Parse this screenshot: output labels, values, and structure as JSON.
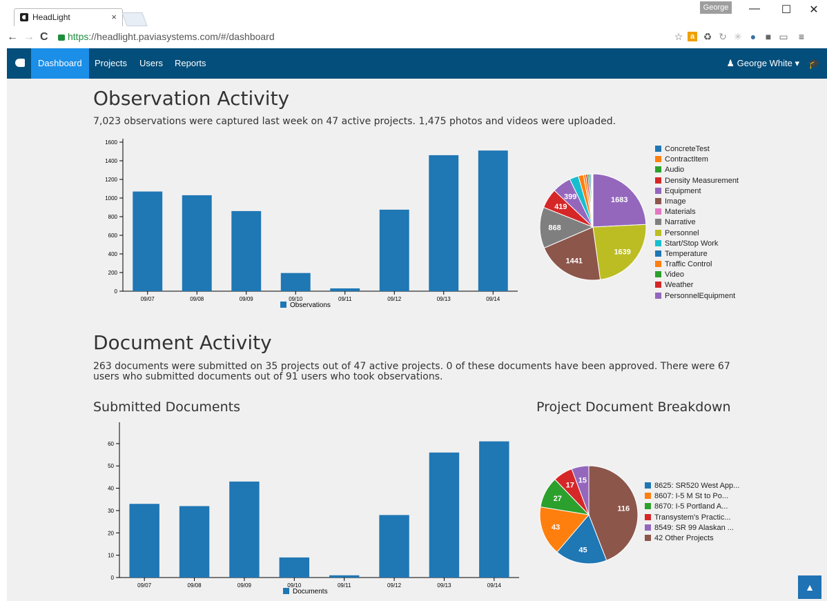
{
  "browser": {
    "tab_title": "HeadLight",
    "tab_close": "×",
    "profile_name": "George",
    "url_scheme": "https",
    "url_rest": "://headlight.paviasystems.com/#/dashboard",
    "win_min": "—",
    "win_max": "☐",
    "win_close": "✕"
  },
  "nav": {
    "items": [
      {
        "label": "Dashboard",
        "active": true
      },
      {
        "label": "Projects"
      },
      {
        "label": "Users"
      },
      {
        "label": "Reports"
      }
    ],
    "user": "George White",
    "user_caret": "▾"
  },
  "observation": {
    "title": "Observation Activity",
    "summary": "7,023 observations were captured last week on 47 active projects. 1,475 photos and videos were uploaded."
  },
  "documents": {
    "title": "Document Activity",
    "summary_line1": "263 documents were submitted on 35 projects out of 47 active projects. 0 of these documents have been approved. There were 67",
    "summary_line2": "users who submitted documents out of 91 users who took observations.",
    "submitted_title": "Submitted Documents",
    "breakdown_title": "Project Document Breakdown"
  },
  "colors": {
    "accent": "#1f77b4",
    "navbar": "#034e7b",
    "nav_active": "#1b8ee8"
  },
  "chart_data": [
    {
      "type": "bar",
      "categories": [
        "09/07",
        "09/08",
        "09/09",
        "09/10",
        "09/11",
        "09/12",
        "09/13",
        "09/14"
      ],
      "values": [
        1070,
        1030,
        860,
        195,
        30,
        875,
        1460,
        1510
      ],
      "ylim": [
        0,
        1600
      ],
      "yticks": [
        0,
        200,
        400,
        600,
        800,
        1000,
        1200,
        1400,
        1600
      ],
      "legend": [
        "Observations"
      ],
      "color": "#1f77b4"
    },
    {
      "type": "pie",
      "labels": [
        "ConcreteTest",
        "ContractItem",
        "Audio",
        "Density Measurement",
        "Equipment",
        "Image",
        "Materials",
        "Narrative",
        "Personnel",
        "Start/Stop Work",
        "Temperature",
        "Traffic Control",
        "Video",
        "Weather",
        "PersonnelEquipment"
      ],
      "colors": [
        "#1f77b4",
        "#ff7f0e",
        "#2ca02c",
        "#d62728",
        "#9467bd",
        "#8c564b",
        "#e377c2",
        "#7f7f7f",
        "#bcbd22",
        "#17becf",
        "#1f77b4",
        "#ff7f0e",
        "#2ca02c",
        "#d62728",
        "#9467bd"
      ],
      "slices": [
        {
          "label": "PersonnelEquipment",
          "value": 1683,
          "color": "#9467bd"
        },
        {
          "label": "Personnel",
          "value": 1639,
          "color": "#bcbd22"
        },
        {
          "label": "Image",
          "value": 1441,
          "color": "#8c564b"
        },
        {
          "label": "Narrative",
          "value": 868,
          "color": "#7f7f7f"
        },
        {
          "label": "Density Measurement",
          "value": 419,
          "color": "#d62728"
        },
        {
          "label": "Equipment",
          "value": 399,
          "color": "#9467bd"
        },
        {
          "label": "Start/Stop Work",
          "value": 190,
          "color": "#17becf"
        },
        {
          "label": "Traffic Control",
          "value": 110,
          "color": "#ff7f0e"
        },
        {
          "label": "ContractItem",
          "value": 50,
          "color": "#ff7f0e"
        },
        {
          "label": "Weather",
          "value": 40,
          "color": "#d62728"
        },
        {
          "label": "Video",
          "value": 35,
          "color": "#2ca02c"
        },
        {
          "label": "Temperature",
          "value": 30,
          "color": "#1f77b4"
        },
        {
          "label": "Audio",
          "value": 20,
          "color": "#2ca02c"
        },
        {
          "label": "ConcreteTest",
          "value": 15,
          "color": "#1f77b4"
        },
        {
          "label": "Materials",
          "value": 10,
          "color": "#e377c2"
        }
      ],
      "legend_position": "right"
    },
    {
      "type": "bar",
      "categories": [
        "09/07",
        "09/08",
        "09/09",
        "09/10",
        "09/11",
        "09/12",
        "09/13",
        "09/14"
      ],
      "values": [
        33,
        32,
        43,
        9,
        1,
        28,
        56,
        61
      ],
      "ylim": [
        0,
        68
      ],
      "yticks": [
        0,
        10,
        20,
        30,
        40,
        50,
        60
      ],
      "legend": [
        "Documents"
      ],
      "color": "#1f77b4"
    },
    {
      "type": "pie",
      "title": "Project Document Breakdown",
      "labels": [
        "8625: SR520 West App...",
        "8607: I-5 M St to Po...",
        "8670: I-5 Portland A...",
        "Transystem's Practic...",
        "8549: SR 99 Alaskan ...",
        "42 Other Projects"
      ],
      "colors": [
        "#1f77b4",
        "#ff7f0e",
        "#2ca02c",
        "#d62728",
        "#9467bd",
        "#8c564b"
      ],
      "slices": [
        {
          "label": "42 Other Projects",
          "value": 116,
          "color": "#8c564b"
        },
        {
          "label": "8625: SR520 West App...",
          "value": 45,
          "color": "#1f77b4"
        },
        {
          "label": "8607: I-5 M St to Po...",
          "value": 43,
          "color": "#ff7f0e"
        },
        {
          "label": "8670: I-5 Portland A...",
          "value": 27,
          "color": "#2ca02c"
        },
        {
          "label": "Transystem's Practic...",
          "value": 17,
          "color": "#d62728"
        },
        {
          "label": "8549: SR 99 Alaskan ...",
          "value": 15,
          "color": "#9467bd"
        }
      ],
      "legend_position": "right"
    }
  ]
}
